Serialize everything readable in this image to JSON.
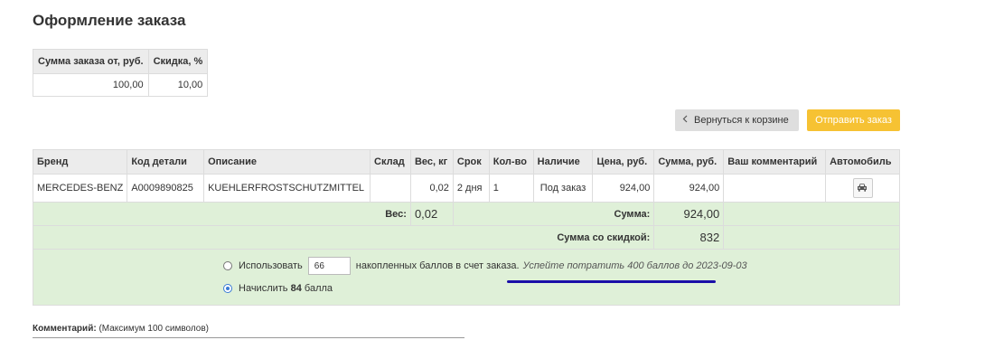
{
  "page": {
    "title": "Оформление заказа"
  },
  "discount_table": {
    "headers": [
      "Сумма заказа от, руб.",
      "Скидка, %"
    ],
    "rows": [
      [
        "100,00",
        "10,00"
      ]
    ]
  },
  "buttons": {
    "back_label": "Вернуться к корзине",
    "send_label": "Отправить заказ"
  },
  "order_table": {
    "headers": [
      "Бренд",
      "Код детали",
      "Описание",
      "Склад",
      "Вес, кг",
      "Срок",
      "Кол-во",
      "Наличие",
      "Цена, руб.",
      "Сумма, руб.",
      "Ваш комментарий",
      "Автомобиль"
    ],
    "rows": [
      {
        "brand": "MERCEDES-BENZ",
        "part_code": "A0009890825",
        "description": "KUEHLERFROSTSCHUTZMITTEL",
        "warehouse": "",
        "weight": "0,02",
        "term": "2 дня",
        "qty": "1",
        "availability": "Под заказ",
        "price": "924,00",
        "sum": "924,00",
        "comment": ""
      }
    ],
    "car_icon": "car-icon"
  },
  "totals": {
    "weight_label": "Вес:",
    "weight_value": "0,02",
    "sum_label": "Сумма:",
    "sum_value": "924,00",
    "discount_sum_label": "Сумма со скидкой:",
    "discount_sum_value": "832"
  },
  "bonus": {
    "use_label": "Использовать",
    "use_value": "66",
    "use_suffix": "накопленных баллов в счет заказа.",
    "expire_hint": "Успейте потратить 400 баллов до 2023-09-03",
    "accrue_prefix": "Начислить",
    "accrue_points": "84",
    "accrue_suffix": "балла",
    "selected": "accrue"
  },
  "comment": {
    "label": "Комментарий:",
    "hint": "(Максимум 100 символов)"
  },
  "colors": {
    "accent_button": "#f6c233",
    "green_row": "#dff0d8",
    "annotation_underline": "#1a0fa8"
  }
}
